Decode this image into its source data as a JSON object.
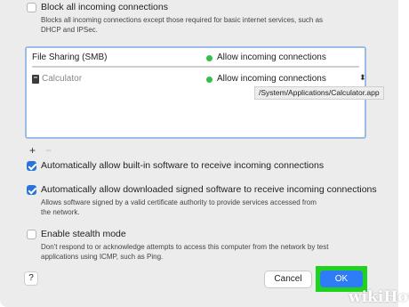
{
  "block_all": {
    "checked": false,
    "label": "Block all incoming connections",
    "description_line1": "Blocks all incoming connections except those required for basic internet services, such as",
    "description_line2": "DHCP and IPSec."
  },
  "list": {
    "rows": [
      {
        "name": "File Sharing (SMB)",
        "status": "Allow incoming connections",
        "status_color": "#33c04a"
      },
      {
        "name": "Calculator",
        "status": "Allow incoming connections",
        "status_color": "#33c04a",
        "icon": "calculator-app-icon"
      }
    ],
    "tooltip": "/System/Applications/Calculator.app",
    "add_label": "+",
    "remove_label": "−"
  },
  "auto_builtin": {
    "checked": true,
    "label": "Automatically allow built-in software to receive incoming connections"
  },
  "auto_signed": {
    "checked": true,
    "label": "Automatically allow downloaded signed software to receive incoming connections",
    "description_line1": "Allows software signed by a valid certificate authority to provide services accessed from",
    "description_line2": "the network."
  },
  "stealth": {
    "checked": false,
    "label": "Enable stealth mode",
    "description_line1": "Don't respond to or acknowledge attempts to access this computer from the network by test",
    "description_line2": "applications using ICMP, such as Ping."
  },
  "footer": {
    "help_label": "?",
    "cancel_label": "Cancel",
    "ok_label": "OK"
  },
  "watermark": "wikiHow",
  "colors": {
    "accent": "#2f7df6",
    "highlight": "#1ed31e",
    "status_green": "#33c04a"
  }
}
